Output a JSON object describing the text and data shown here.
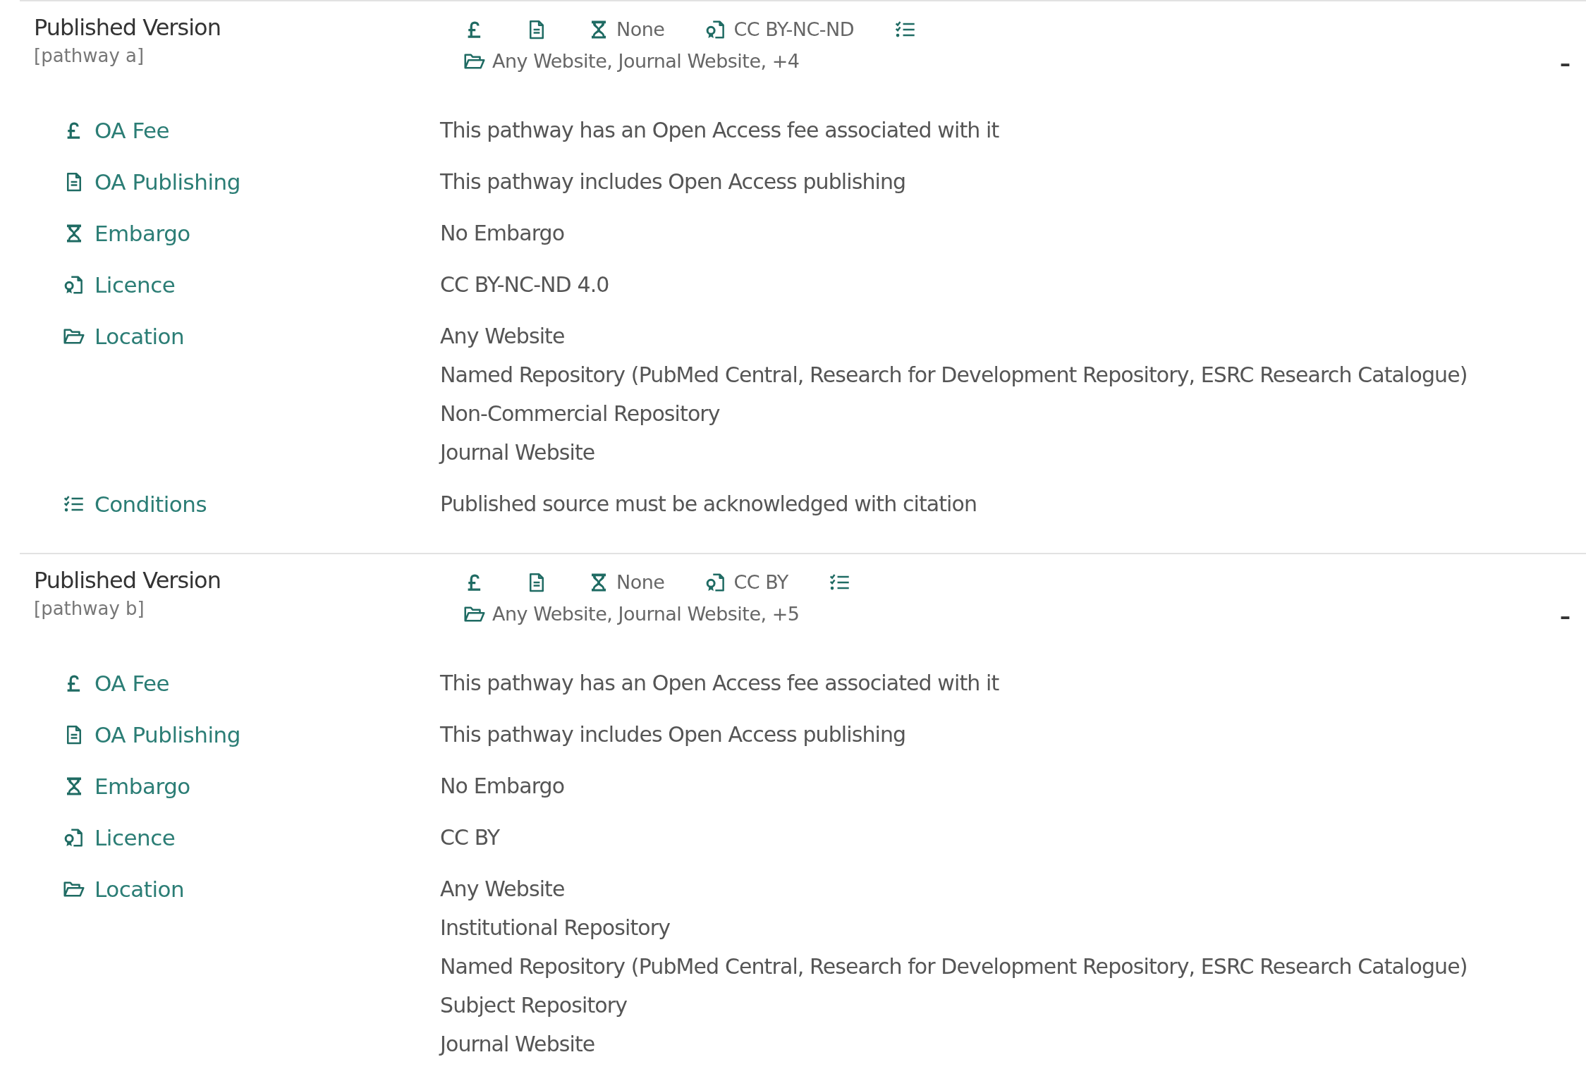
{
  "pathways": [
    {
      "title": "Published Version",
      "subtitle": "[pathway a]",
      "expanded": true,
      "toggle": "–",
      "summary": [
        {
          "kind": "fee"
        },
        {
          "kind": "publishing"
        },
        {
          "kind": "embargo",
          "text": "None"
        },
        {
          "kind": "licence",
          "text": "CC BY-NC-ND"
        },
        {
          "kind": "conditions"
        }
      ],
      "locations_summary": "Any Website, Journal Website, +4",
      "details": [
        {
          "kind": "fee",
          "label": "OA Fee",
          "values": [
            "This pathway has an Open Access fee associated with it"
          ]
        },
        {
          "kind": "publishing",
          "label": "OA Publishing",
          "values": [
            "This pathway includes Open Access publishing"
          ]
        },
        {
          "kind": "embargo",
          "label": "Embargo",
          "values": [
            "No Embargo"
          ]
        },
        {
          "kind": "licence",
          "label": "Licence",
          "values": [
            "CC BY-NC-ND 4.0"
          ]
        },
        {
          "kind": "location",
          "label": "Location",
          "values": [
            "Any Website",
            "Named Repository (PubMed Central, Research for Development Repository, ESRC Research Catalogue)",
            "Non-Commercial Repository",
            "Journal Website"
          ]
        },
        {
          "kind": "conditions",
          "label": "Conditions",
          "values": [
            "Published source must be acknowledged with citation"
          ]
        }
      ]
    },
    {
      "title": "Published Version",
      "subtitle": "[pathway b]",
      "expanded": true,
      "toggle": "–",
      "summary": [
        {
          "kind": "fee"
        },
        {
          "kind": "publishing"
        },
        {
          "kind": "embargo",
          "text": "None"
        },
        {
          "kind": "licence",
          "text": "CC BY"
        },
        {
          "kind": "conditions"
        }
      ],
      "locations_summary": "Any Website, Journal Website, +5",
      "details": [
        {
          "kind": "fee",
          "label": "OA Fee",
          "values": [
            "This pathway has an Open Access fee associated with it"
          ]
        },
        {
          "kind": "publishing",
          "label": "OA Publishing",
          "values": [
            "This pathway includes Open Access publishing"
          ]
        },
        {
          "kind": "embargo",
          "label": "Embargo",
          "values": [
            "No Embargo"
          ]
        },
        {
          "kind": "licence",
          "label": "Licence",
          "values": [
            "CC BY"
          ]
        },
        {
          "kind": "location",
          "label": "Location",
          "values": [
            "Any Website",
            "Institutional Repository",
            "Named Repository (PubMed Central, Research for Development Repository, ESRC Research Catalogue)",
            "Subject Repository",
            "Journal Website"
          ]
        }
      ]
    }
  ]
}
